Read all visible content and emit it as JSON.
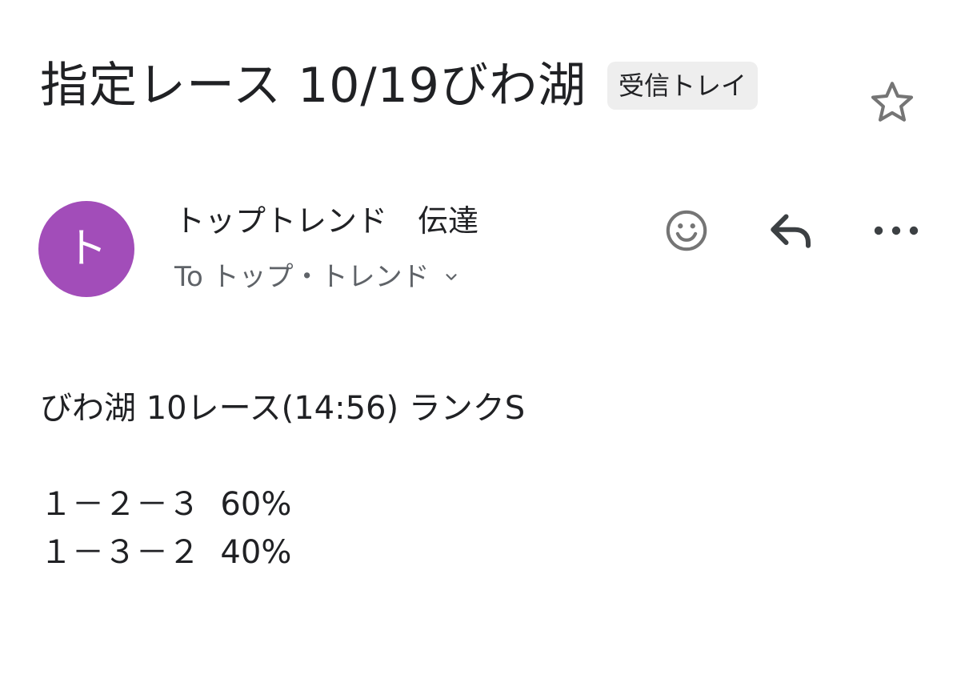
{
  "email": {
    "subject": "指定レース 10/19びわ湖",
    "label_chip": "受信トレイ",
    "sender": {
      "avatar_letter": "ト",
      "avatar_color": "#a24db9",
      "name": "トップトレンド　伝達",
      "recipient_line": "To トップ・トレンド"
    },
    "actions": {
      "star_icon": "star-outline-icon",
      "emoji_icon": "smiley-face-icon",
      "reply_icon": "reply-arrow-icon",
      "more_icon": "more-horizontal-icon"
    },
    "body_lines": [
      "びわ湖 10レース(14:56) ランクS",
      "",
      "１－２－３  60%",
      "１－３－２  40%"
    ]
  }
}
